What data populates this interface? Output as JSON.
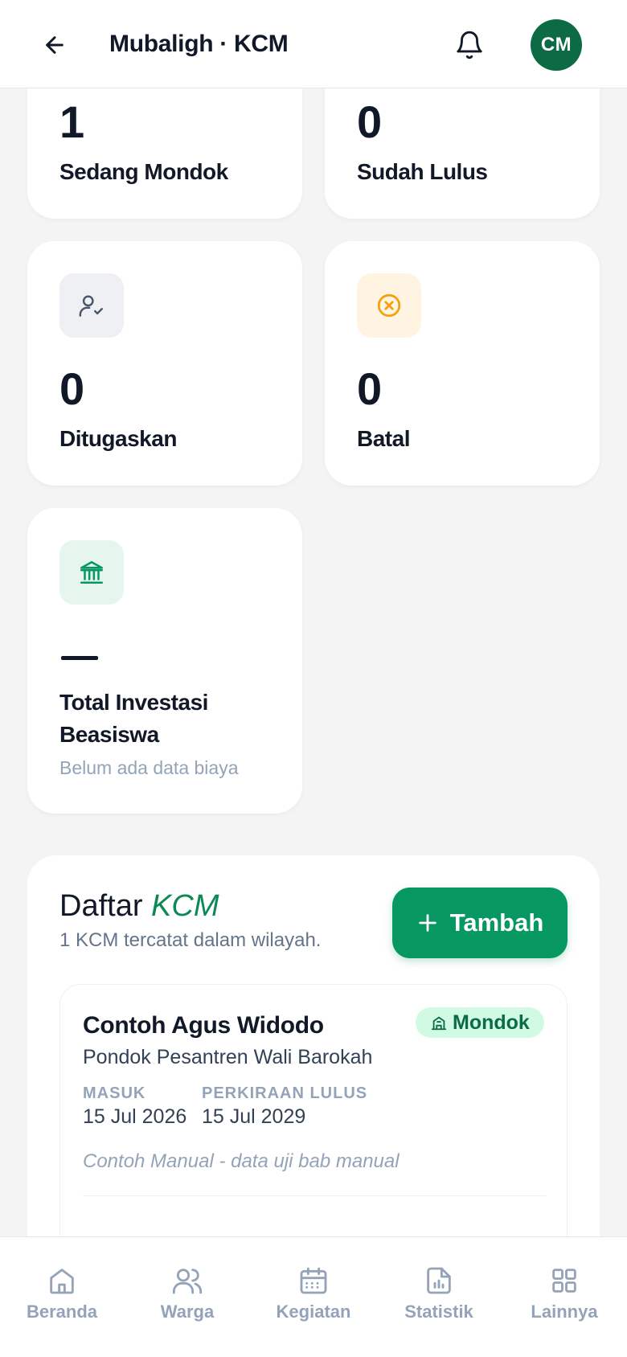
{
  "header": {
    "title": "Mubaligh · KCM",
    "avatar_initials": "CM",
    "avatar_color": "#0c6b45"
  },
  "stats": {
    "sedang_mondok": {
      "value": "1",
      "label": "Sedang Mondok"
    },
    "sudah_lulus": {
      "value": "0",
      "label": "Sudah Lulus"
    },
    "ditugaskan": {
      "value": "0",
      "label": "Ditugaskan",
      "icon": "user-check-icon"
    },
    "batal": {
      "value": "0",
      "label": "Batal",
      "icon": "x-circle-icon",
      "accent": "#f59e0b"
    },
    "investasi": {
      "value": "—",
      "label_line1": "Total Investasi",
      "label_line2": "Beasiswa",
      "sub": "Belum ada data biaya",
      "icon": "bank-icon",
      "accent": "#079861"
    }
  },
  "list": {
    "title_prefix": "Daftar",
    "title_accent": "KCM",
    "subtitle": "1 KCM tercatat dalam wilayah.",
    "add_label": "Tambah",
    "items": [
      {
        "name": "Contoh Agus Widodo",
        "school": "Pondok Pesantren Wali Barokah",
        "status": "Mondok",
        "masuk_label": "MASUK",
        "masuk_value": "15 Jul 2026",
        "lulus_label": "PERKIRAAN LULUS",
        "lulus_value": "15 Jul 2029",
        "note": "Contoh Manual - data uji bab manual"
      }
    ]
  },
  "nav": {
    "items": [
      {
        "label": "Beranda",
        "icon": "home-icon"
      },
      {
        "label": "Warga",
        "icon": "users-icon"
      },
      {
        "label": "Kegiatan",
        "icon": "calendar-icon"
      },
      {
        "label": "Statistik",
        "icon": "chart-file-icon"
      },
      {
        "label": "Lainnya",
        "icon": "grid-icon"
      }
    ]
  }
}
